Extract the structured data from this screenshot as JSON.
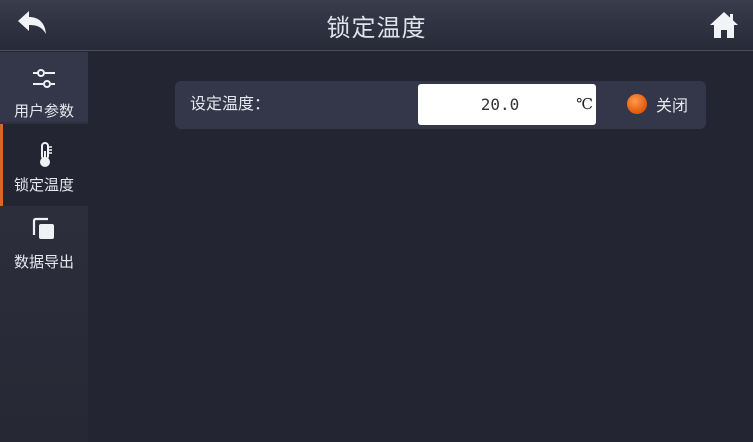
{
  "header": {
    "title": "锁定温度",
    "back_icon": "back-arrow-icon",
    "home_icon": "home-icon"
  },
  "sidebar": {
    "items": [
      {
        "label": "用户参数",
        "icon": "sliders-icon",
        "state": "normal"
      },
      {
        "label": "锁定温度",
        "icon": "thermometer-icon",
        "state": "selected"
      },
      {
        "label": "数据导出",
        "icon": "copy-icon",
        "state": "normal"
      }
    ]
  },
  "panel": {
    "label": "设定温度：",
    "value": "20.0",
    "unit": "℃",
    "status": {
      "text": "关闭",
      "color": "#e2580d"
    }
  },
  "colors": {
    "background": "#232532",
    "accent": "#d8652a"
  }
}
